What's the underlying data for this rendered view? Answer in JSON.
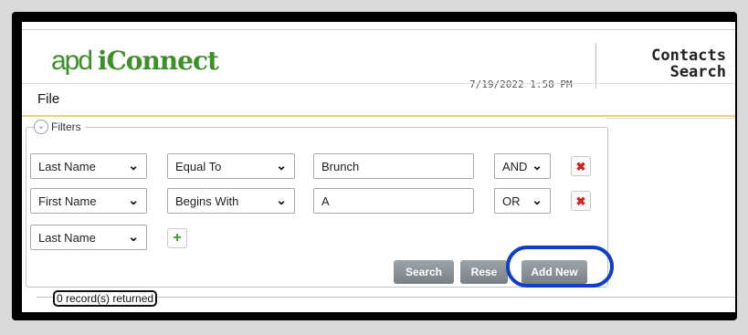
{
  "header": {
    "logo_apd": "apd",
    "logo_iconnect": "iConnect",
    "datetime": "7/19/2022 1:58 PM",
    "title_line1": "Contacts",
    "title_line2": "Search"
  },
  "menu": {
    "file": "File"
  },
  "filters": {
    "legend": "Filters",
    "rows": [
      {
        "field": "Last Name",
        "operator": "Equal To",
        "value": "Brunch",
        "conjunction": "AND"
      },
      {
        "field": "First Name",
        "operator": "Begins With",
        "value": "A",
        "conjunction": "OR"
      }
    ],
    "new_row_field": "Last Name",
    "chevron": "⌄",
    "delete_glyph": "✖",
    "add_glyph": "+"
  },
  "buttons": {
    "search": "Search",
    "reset": "Rese",
    "add_new": "Add New"
  },
  "results": {
    "records_returned": "0 record(s) returned"
  },
  "colors": {
    "brand_green": "#3d8f2a",
    "highlight_blue": "#0f3fc4",
    "delete_red": "#d32020",
    "add_green": "#3b9a2a"
  },
  "icons": {
    "collapse": "collapse-circle-icon",
    "delete": "delete-x-icon",
    "add": "add-plus-icon"
  }
}
